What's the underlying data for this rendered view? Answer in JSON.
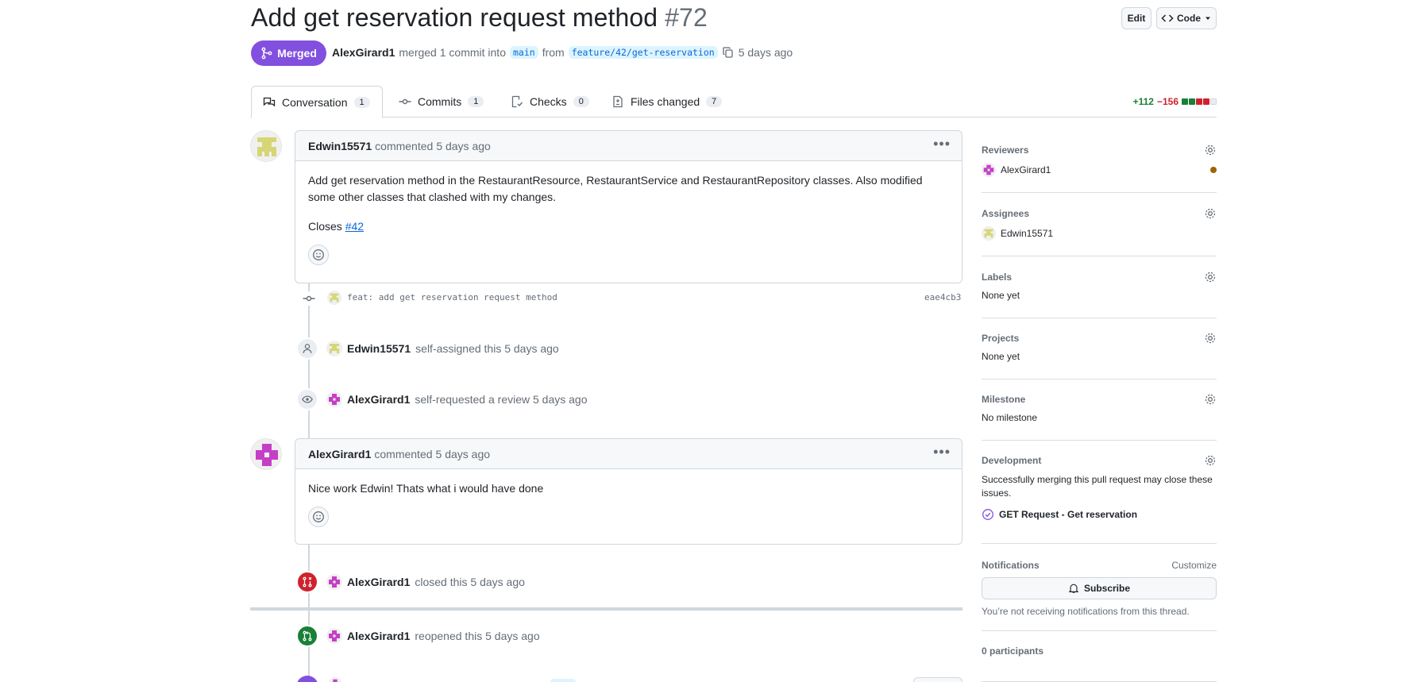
{
  "header": {
    "title": "Add get reservation request method",
    "number": "#72",
    "edit_label": "Edit",
    "code_label": "Code",
    "state": "Merged",
    "author": "AlexGirard1",
    "merge_text": "merged 1 commit into",
    "base_branch": "main",
    "from_text": "from",
    "head_branch": "feature/42/get-reservation",
    "time": "5 days ago"
  },
  "tabs": [
    {
      "label": "Conversation",
      "count": "1",
      "icon": "comment-discussion-icon"
    },
    {
      "label": "Commits",
      "count": "1",
      "icon": "git-commit-icon"
    },
    {
      "label": "Checks",
      "count": "0",
      "icon": "checklist-icon"
    },
    {
      "label": "Files changed",
      "count": "7",
      "icon": "file-diff-icon"
    }
  ],
  "diffstat": {
    "additions": "+112",
    "deletions": "−156"
  },
  "timeline": {
    "comment1": {
      "author": "Edwin15571",
      "action": "commented",
      "time": "5 days ago",
      "body": "Add get reservation method in the RestaurantResource, RestaurantService and RestaurantRepository classes. Also modified some other classes that clashed with my changes.",
      "closes_prefix": "Closes",
      "closes_link": "#42"
    },
    "commit": {
      "message": "feat: add get reservation request method",
      "sha": "eae4cb3"
    },
    "assigned": {
      "actor": "Edwin15571",
      "text": "self-assigned this 5 days ago"
    },
    "review_requested": {
      "actor": "AlexGirard1",
      "text": "self-requested a review 5 days ago"
    },
    "comment2": {
      "author": "AlexGirard1",
      "action": "commented",
      "time": "5 days ago",
      "body": "Nice work Edwin! Thats what i would have done"
    },
    "closed": {
      "actor": "AlexGirard1",
      "text": "closed this 5 days ago"
    },
    "reopened": {
      "actor": "AlexGirard1",
      "text": "reopened this 5 days ago"
    }
  },
  "sidebar": {
    "reviewers": {
      "title": "Reviewers",
      "name": "AlexGirard1"
    },
    "assignees": {
      "title": "Assignees",
      "name": "Edwin15571"
    },
    "labels": {
      "title": "Labels",
      "value": "None yet"
    },
    "projects": {
      "title": "Projects",
      "value": "None yet"
    },
    "milestone": {
      "title": "Milestone",
      "value": "No milestone"
    },
    "development": {
      "title": "Development",
      "note": "Successfully merging this pull request may close these issues.",
      "issue": "GET Request - Get reservation"
    },
    "notifications": {
      "title": "Notifications",
      "customize": "Customize",
      "subscribe": "Subscribe",
      "note": "You’re not receiving notifications from this thread."
    },
    "participants": "0 participants"
  },
  "colors": {
    "merged": "#8250df",
    "closed": "#cf222e",
    "open": "#1a7f37",
    "link": "#0969da",
    "pending_review": "#9a6700"
  }
}
